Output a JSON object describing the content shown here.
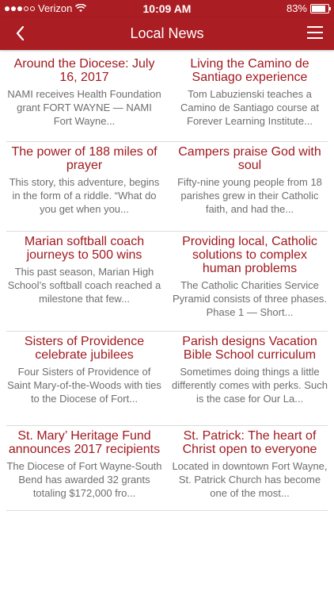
{
  "status": {
    "carrier": "Verizon",
    "time": "10:09 AM",
    "battery": "83%"
  },
  "nav": {
    "title": "Local News"
  },
  "articles": [
    {
      "title": "Around the Diocese: July 16, 2017",
      "summary": "NAMI receives Health Foundation grant FORT WAYNE — NAMI Fort Wayne..."
    },
    {
      "title": "Living the Camino de Santiago experience",
      "summary": "Tom Labuzienski teaches a Camino de Santiago course at Forever Learning Institute..."
    },
    {
      "title": "The power of 188 miles of prayer",
      "summary": "This story, this adventure, begins in the form of a riddle. “What do you get when you..."
    },
    {
      "title": "Campers praise God with soul",
      "summary": "Fifty-nine young people from 18 parishes grew in their Catholic faith, and had the..."
    },
    {
      "title": "Marian softball coach journeys to 500 wins",
      "summary": "This past season, Marian High School’s softball coach reached a milestone that few..."
    },
    {
      "title": "Providing local, Catholic solutions to complex human problems",
      "summary": "The Catholic Charities Service Pyramid consists of three phases. Phase 1 — Short..."
    },
    {
      "title": "Sisters of Providence celebrate jubilees",
      "summary": "Four Sisters of Providence of Saint Mary-of-the-Woods with ties to the Diocese of Fort..."
    },
    {
      "title": "Parish designs Vacation Bible School curriculum",
      "summary": "Sometimes doing things a little differently comes with perks. Such is the case for Our La..."
    },
    {
      "title": "St. Mary’ Heritage Fund announces 2017 recipients",
      "summary": "The Diocese of Fort Wayne-South Bend has awarded 32 grants totaling $172,000 fro..."
    },
    {
      "title": "St. Patrick: The heart of Christ open to everyone",
      "summary": "Located in downtown Fort Wayne, St. Patrick Church has become one of the most..."
    }
  ]
}
